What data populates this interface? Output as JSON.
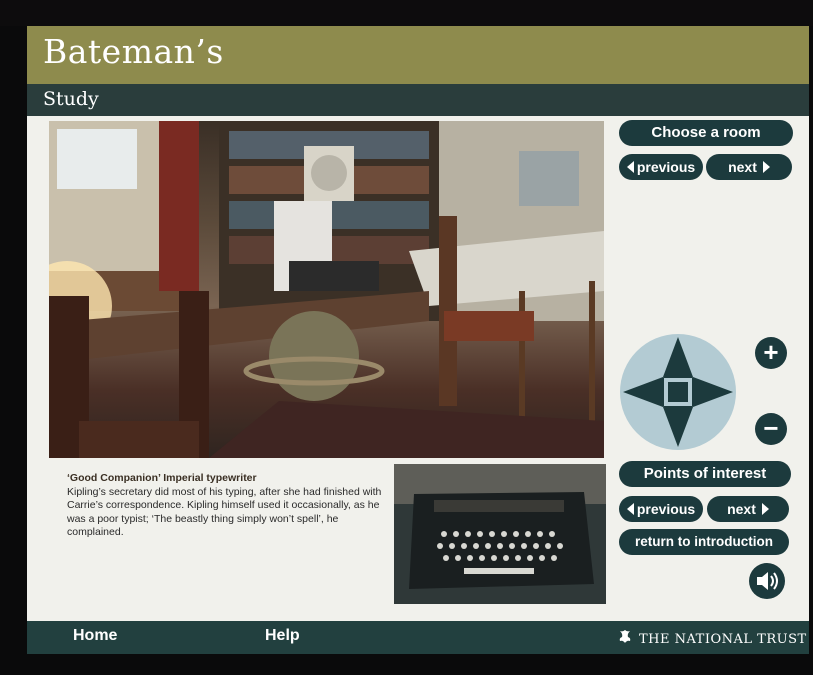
{
  "header": {
    "title": "Bateman’s",
    "room_name": "Study"
  },
  "room_nav": {
    "choose_label": "Choose a room",
    "previous_label": "previous",
    "next_label": "next"
  },
  "zoom": {
    "in_label": "+",
    "out_label": "−"
  },
  "points_of_interest": {
    "label": "Points of interest",
    "previous_label": "previous",
    "next_label": "next",
    "return_label": "return to introduction"
  },
  "description": {
    "title": "‘Good Companion’ Imperial typewriter",
    "body": "Kipling’s secretary did most of his typing, after she had finished with Carrie’s correspondence. Kipling himself used it occasionally, as he was a poor typist; ‘The beastly thing simply won’t spell’, he complained."
  },
  "footer": {
    "home_label": "Home",
    "help_label": "Help",
    "brand": "THE NATIONAL TRUST"
  },
  "icons": {
    "sound": "speaker-icon",
    "nav_pad": "directional-pad-icon",
    "brand_logo": "oak-leaf-icon"
  },
  "colors": {
    "header_olive": "#8e8b4d",
    "dark_teal": "#1c3a3d",
    "screen_bg": "#f1f1ec"
  }
}
